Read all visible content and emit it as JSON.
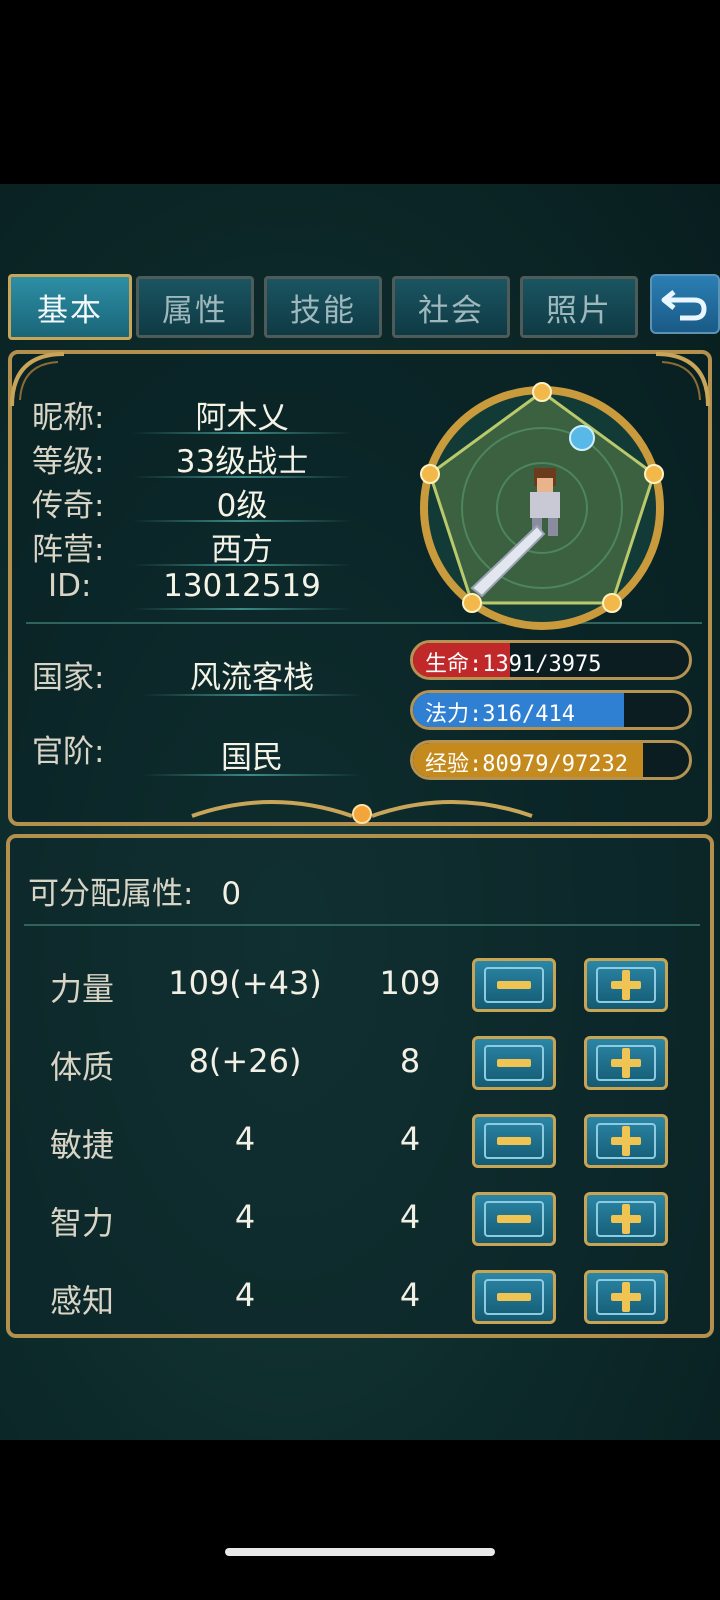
{
  "tabs": [
    {
      "label": "基本",
      "active": true
    },
    {
      "label": "属性",
      "active": false
    },
    {
      "label": "技能",
      "active": false
    },
    {
      "label": "社会",
      "active": false
    },
    {
      "label": "照片",
      "active": false
    }
  ],
  "back_icon": "return-arrow-icon",
  "profile": {
    "nickname_label": "昵称:",
    "nickname": "阿木乂",
    "level_label": "等级:",
    "level": "33级战士",
    "legend_label": "传奇:",
    "legend": "0级",
    "camp_label": "阵营:",
    "camp": "西方",
    "id_label": "ID:",
    "id": "13012519",
    "country_label": "国家:",
    "country": "风流客栈",
    "rank_label": "官阶:",
    "rank": "国民"
  },
  "bars": {
    "hp": {
      "text": "生命:1391/3975",
      "current": 1391,
      "max": 3975,
      "color": "#c0282a"
    },
    "mp": {
      "text": "法力:316/414",
      "current": 316,
      "max": 414,
      "color": "#2f7fd2"
    },
    "exp": {
      "text": "经验:80979/97232",
      "current": 80979,
      "max": 97232,
      "color": "#c58a1e"
    }
  },
  "attributes": {
    "points_label": "可分配属性:",
    "points": "0",
    "rows": [
      {
        "name": "力量",
        "total": "109(+43)",
        "base": "109"
      },
      {
        "name": "体质",
        "total": "8(+26)",
        "base": "8"
      },
      {
        "name": "敏捷",
        "total": "4",
        "base": "4"
      },
      {
        "name": "智力",
        "total": "4",
        "base": "4"
      },
      {
        "name": "感知",
        "total": "4",
        "base": "4"
      }
    ]
  },
  "colors": {
    "gold": "#b3904d",
    "teal_bg": "#0d2a2a",
    "tab_active": "#2d8fa5"
  }
}
